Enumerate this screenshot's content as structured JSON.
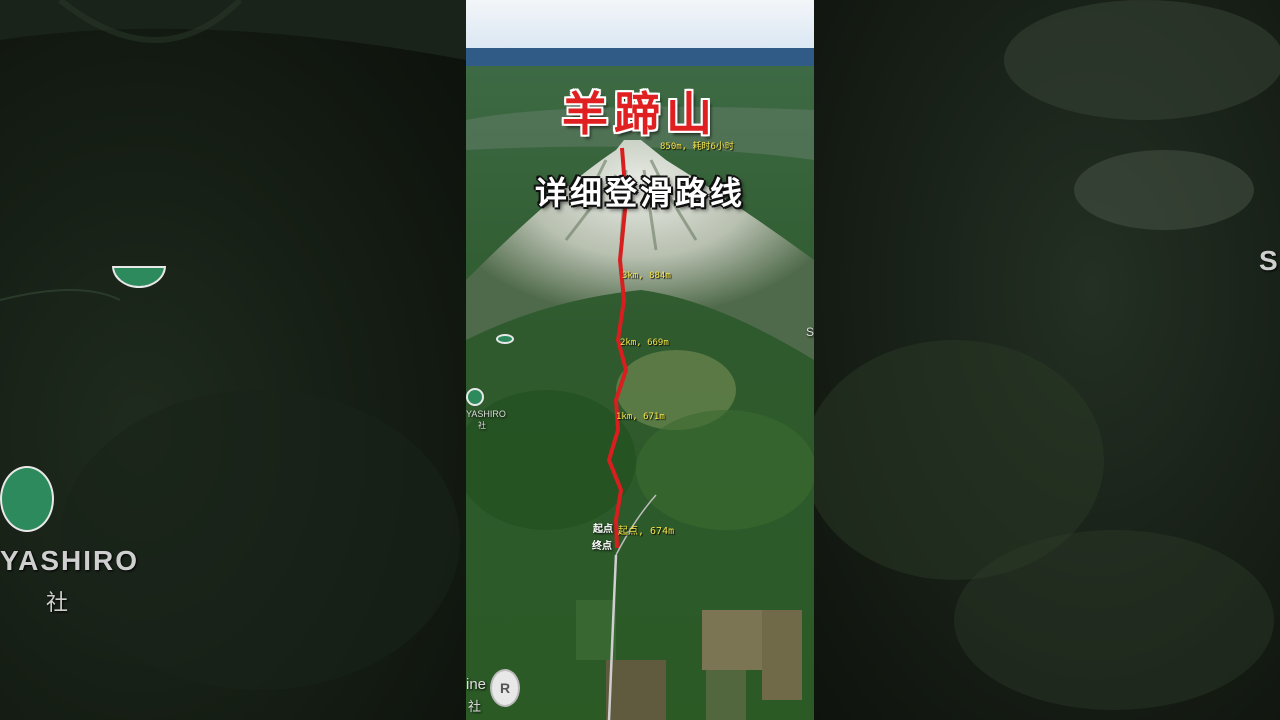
{
  "title": "羊蹄山",
  "subtitle": "详细登滑路线",
  "summit_label": "850m, 耗时6小时",
  "route_markers": [
    {
      "text": "3km, 884m"
    },
    {
      "text": "2km, 669m"
    },
    {
      "text": "1km, 671m"
    }
  ],
  "start_label": "起点",
  "start_elev_label": "起点, 674m",
  "end_label": "终点",
  "place_left": "YASHIRO",
  "place_left_kanji": "社",
  "place_center": "YASHIRO",
  "place_center_kanji": "社",
  "bottom_partial_text": "ine",
  "bottom_partial_kanji": "社",
  "bottom_pin_letter": "R",
  "right_partial_letter": "S",
  "right_edge_letter": "S",
  "colors": {
    "route": "#d81e1e",
    "title": "#e02020",
    "marker_text": "#f5e34a"
  }
}
